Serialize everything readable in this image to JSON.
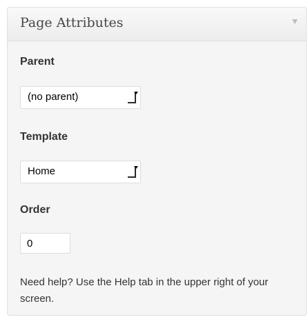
{
  "panel": {
    "title": "Page Attributes",
    "toggle_icon": "triangle-down-icon"
  },
  "parent": {
    "label": "Parent",
    "selected": "(no parent)"
  },
  "template": {
    "label": "Template",
    "selected": "Home"
  },
  "order": {
    "label": "Order",
    "value": "0"
  },
  "help": {
    "text": "Need help? Use the Help tab in the upper right of your screen."
  }
}
